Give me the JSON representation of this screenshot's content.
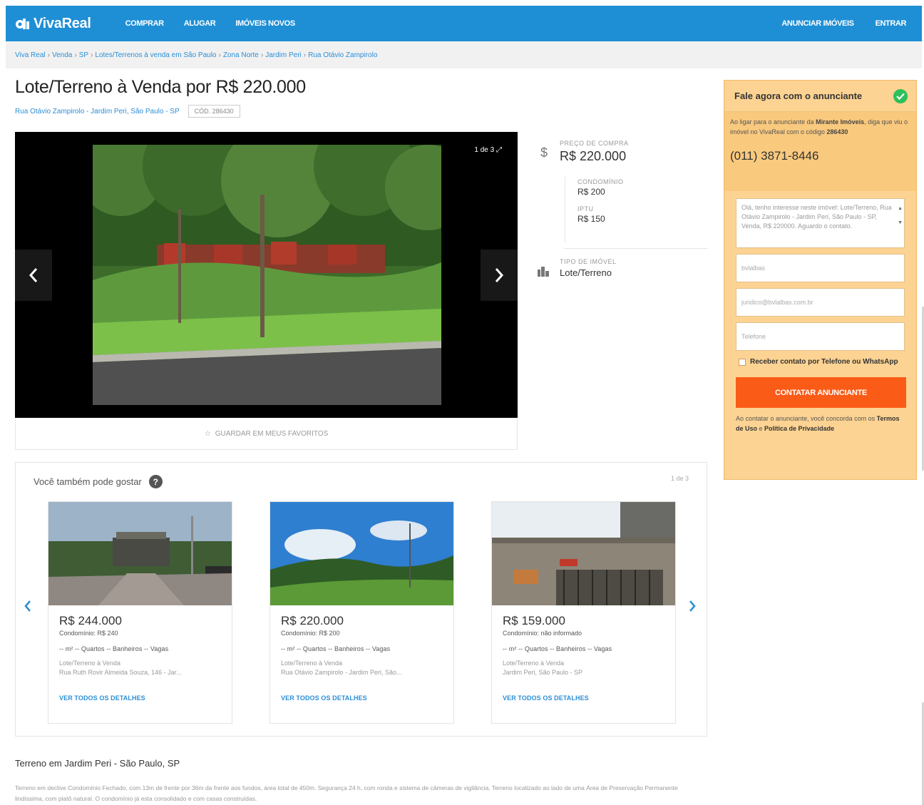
{
  "nav": {
    "logo": "VivaReal",
    "left_links": [
      "COMPRAR",
      "ALUGAR",
      "IMÓVEIS NOVOS"
    ],
    "right_links": [
      "ANUNCIAR IMÓVEIS",
      "ENTRAR"
    ],
    "color": "#1e8fd5"
  },
  "breadcrumb": [
    "Viva Real",
    "Venda",
    "SP",
    "Lotes/Terrenos à venda em São Paulo",
    "Zona Norte",
    "Jardim Peri",
    "Rua Otávio Zampirolo"
  ],
  "listing": {
    "title": "Lote/Terreno à Venda por R$ 220.000",
    "address": "Rua Otávio Zampirolo - Jardim Peri, São Paulo - SP",
    "code": "CÓD. 286430",
    "photo_counter": "1 de 3",
    "favorite_label": "GUARDAR EM MEUS FAVORITOS"
  },
  "prices": {
    "purchase_label": "PREÇO DE COMPRA",
    "purchase_value": "R$ 220.000",
    "condo_label": "CONDOMÍNIO",
    "condo_value": "R$ 200",
    "iptu_label": "IPTU",
    "iptu_value": "R$ 150",
    "type_label": "TIPO DE IMÓVEL",
    "type_value": "Lote/Terreno"
  },
  "contact": {
    "header": "Fale agora com o anunciante",
    "info_prefix": "Ao ligar para o anunciante da ",
    "info_agency": "Mirante Imóveis",
    "info_mid": ", diga que viu o imóvel no VivaReal com o código ",
    "info_code": "286430",
    "phone": "(011) 3871-8446",
    "message": "Olá, tenho interesse neste imóvel: Lote/Terreno, Rua Otávio Zampirolo - Jardim Peri, São Paulo - SP, Venda, R$ 220000. Aguardo o contato.",
    "name_value": "bvlalbas",
    "email_value": "juridico@bvlalbas.com.br",
    "phone_placeholder": "Telefone",
    "checkbox_label": "Receber contato por Telefone ou WhatsApp",
    "cta": "CONTATAR ANUNCIANTE",
    "terms_prefix": "Ao contatar o anunciante, você concorda com os ",
    "terms_link1": "Termos de Uso",
    "terms_mid": " e ",
    "terms_link2": "Política de Privacidade",
    "accent": "#fa5b17",
    "panel_color": "#fcd392"
  },
  "recommendations": {
    "title": "Você também pode gostar",
    "count": "1 de 3",
    "cards": [
      {
        "price": "R$ 244.000",
        "condo": "Condomínio: R$ 240",
        "features": "-- m²   -- Quartos   -- Banheiros   -- Vagas",
        "kind": "Lote/Terreno à Venda",
        "address": "Rua Ruth Rovir Almeida Souza, 146 - Jar...",
        "link": "VER TODOS OS DETALHES"
      },
      {
        "price": "R$ 220.000",
        "condo": "Condomínio: R$ 200",
        "features": "-- m²   -- Quartos   -- Banheiros   -- Vagas",
        "kind": "Lote/Terreno à Venda",
        "address": "Rua Otávio Zampirolo - Jardim Peri, São...",
        "link": "VER TODOS OS DETALHES"
      },
      {
        "price": "R$ 159.000",
        "condo": "Condomínio: não informado",
        "features": "-- m²   -- Quartos   -- Banheiros   -- Vagas",
        "kind": "Lote/Terreno à Venda",
        "address": "Jardim Peri, São Paulo - SP",
        "link": "VER TODOS OS DETALHES"
      }
    ]
  },
  "description": {
    "title": "Terreno em Jardim Peri - São Paulo, SP",
    "text": "Terreno em declive Condomínio Fechado, com 13m de frente por 36m da frente aos fundos, área total de 450m. Segurança 24 h, com ronda e sistema de câmeras de vigilância. Terreno localizado ao lado de uma Área de Preservação Permanente lindíssima, com platô natural. O condomínio já esta consolidado e com casas construídas."
  }
}
